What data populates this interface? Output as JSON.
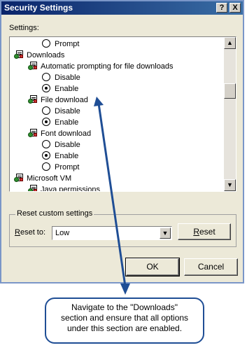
{
  "window": {
    "title": "Security Settings",
    "help_label": "?",
    "close_label": "X"
  },
  "settings_label": "Settings:",
  "tree": [
    {
      "kind": "radio",
      "label": "Prompt",
      "checked": false
    },
    {
      "kind": "category",
      "label": "Downloads"
    },
    {
      "kind": "setting",
      "label": "Automatic prompting for file downloads"
    },
    {
      "kind": "radio",
      "label": "Disable",
      "checked": false
    },
    {
      "kind": "radio",
      "label": "Enable",
      "checked": true
    },
    {
      "kind": "setting",
      "label": "File download"
    },
    {
      "kind": "radio",
      "label": "Disable",
      "checked": false
    },
    {
      "kind": "radio",
      "label": "Enable",
      "checked": true
    },
    {
      "kind": "setting",
      "label": "Font download"
    },
    {
      "kind": "radio",
      "label": "Disable",
      "checked": false
    },
    {
      "kind": "radio",
      "label": "Enable",
      "checked": true
    },
    {
      "kind": "radio",
      "label": "Prompt",
      "checked": false
    },
    {
      "kind": "category",
      "label": "Microsoft VM"
    },
    {
      "kind": "setting",
      "label": "Java permissions"
    }
  ],
  "reset": {
    "group_label": "Reset custom settings",
    "reset_to_label": "Reset to:",
    "selected": "Low",
    "button": "Reset"
  },
  "buttons": {
    "ok": "OK",
    "cancel": "Cancel"
  },
  "callout": {
    "line1": "Navigate to the \"Downloads\"",
    "line2": "section and ensure that all options",
    "line3": "under this section are enabled."
  },
  "colors": {
    "arrow": "#1f4e95",
    "title_bar": "#0a246a"
  }
}
